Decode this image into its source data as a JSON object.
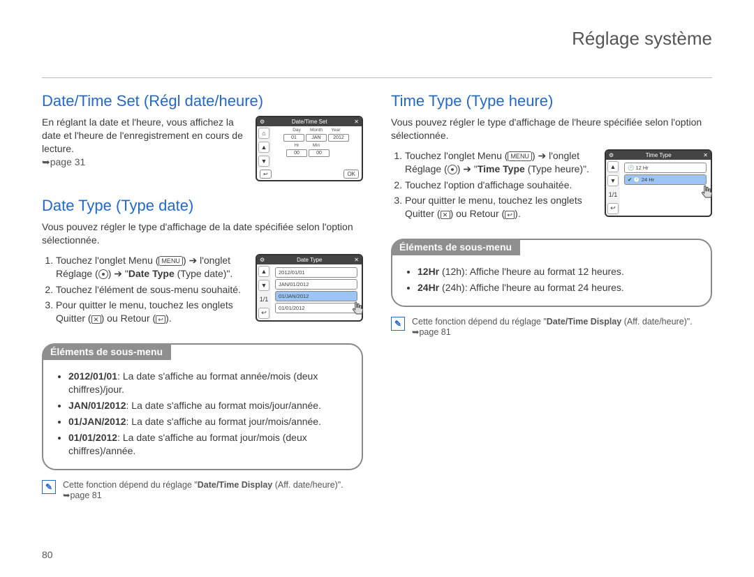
{
  "header": {
    "title": "Réglage système"
  },
  "pageNumber": "80",
  "left": {
    "s1": {
      "heading": "Date/Time Set (Régl date/heure)",
      "para": "En réglant la date et l'heure, vous affichez la date et l'heure de l'enregistrement en cours de lecture.",
      "ref": "➥page 31"
    },
    "screen1": {
      "title": "Date/Time Set",
      "labels": {
        "day": "Day",
        "month": "Month",
        "year": "Year",
        "hr": "Hr",
        "min": "Min"
      },
      "vals": {
        "day": "01",
        "month": "JAN",
        "year": "2012",
        "hr": "00",
        "min": "00"
      },
      "ok": "OK"
    },
    "s2": {
      "heading": "Date Type (Type date)",
      "para": "Vous pouvez régler le type d'affichage de la date spécifiée selon l'option sélectionnée.",
      "step1a": "Touchez l'onglet Menu (",
      "step1b": ") ➔ l'onglet Réglage (",
      "step1c": ") ➔ \"",
      "step1bold": "Date Type",
      "step1d": " (Type date)\".",
      "step2": "Touchez l'élément de sous-menu souhaité.",
      "step3a": "Pour quitter le menu, touchez les onglets Quitter (",
      "step3b": ") ou Retour (",
      "step3c": ")."
    },
    "screen2": {
      "title": "Date Type",
      "items": [
        "2012/01/01",
        "JAN/01/2012",
        "01/JAN/2012",
        "01/01/2012"
      ],
      "page": "1/1"
    },
    "submenu": {
      "title": "Éléments de sous-menu",
      "i1b": "2012/01/01",
      "i1t": ": La date s'affiche au format année/mois (deux chiffres)/jour.",
      "i2b": "JAN/01/2012",
      "i2t": ": La date s'affiche au format mois/jour/année.",
      "i3b": "01/JAN/2012",
      "i3t": ": La date s'affiche au format jour/mois/année.",
      "i4b": "01/01/2012",
      "i4t": ": La date s'affiche au format jour/mois (deux chiffres)/année."
    },
    "note": {
      "a": "Cette fonction dépend du réglage \"",
      "b": "Date/Time Display",
      "c": " (Aff. date/heure)\". ➥page 81"
    }
  },
  "right": {
    "s1": {
      "heading": "Time Type (Type heure)",
      "para": "Vous pouvez régler le type d'affichage de l'heure spécifiée selon l'option sélectionnée.",
      "step1a": "Touchez l'onglet Menu (",
      "step1b": ") ➔ l'onglet Réglage (",
      "step1c": ") ➔ \"",
      "step1bold": "Time Type",
      "step1d": " (Type heure)\".",
      "step2": "Touchez l'option d'affichage souhaitée.",
      "step3a": "Pour quitter le menu, touchez les onglets Quitter (",
      "step3b": ") ou Retour (",
      "step3c": ")."
    },
    "screen": {
      "title": "Time Type",
      "items": [
        "12 Hr",
        "24 Hr"
      ],
      "page": "1/1"
    },
    "submenu": {
      "title": "Éléments de sous-menu",
      "i1b": "12Hr",
      "i1t": " (12h): Affiche l'heure au format 12 heures.",
      "i2b": "24Hr",
      "i2t": " (24h): Affiche l'heure au format 24 heures."
    },
    "note": {
      "a": "Cette fonction dépend du réglage \"",
      "b": "Date/Time Display",
      "c": " (Aff. date/heure)\". ➥page 81"
    }
  },
  "icons": {
    "menu": "MENU",
    "x": "✕",
    "ret": "↩",
    "up": "▲",
    "down": "▼",
    "home": "⌂",
    "gear": "⚙",
    "clock": "🕐",
    "check": "✔"
  }
}
